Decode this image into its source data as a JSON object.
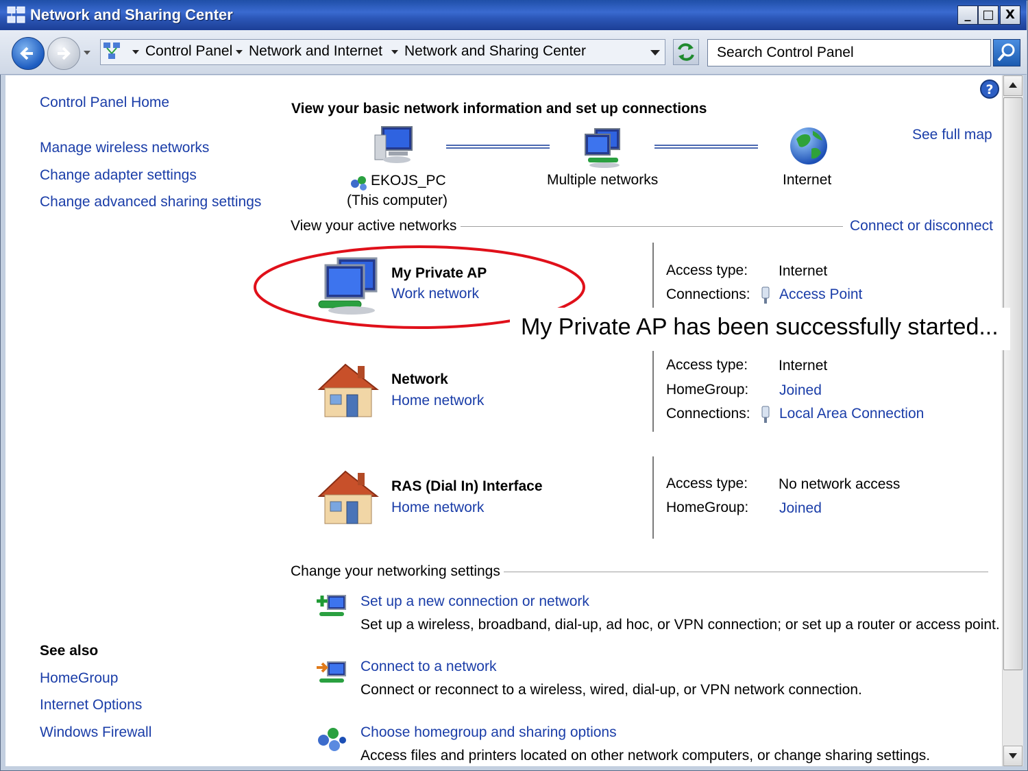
{
  "window": {
    "title": "Network and Sharing Center",
    "buttons": {
      "minimize": "_",
      "maximize": "□",
      "close": "X"
    }
  },
  "nav": {
    "breadcrumbs": [
      "Control Panel",
      "Network and Internet",
      "Network and Sharing Center"
    ],
    "search_placeholder": "Search Control Panel"
  },
  "sidebar": {
    "home_link": "Control Panel Home",
    "tasks": [
      "Manage wireless networks",
      "Change adapter settings",
      "Change advanced sharing settings"
    ],
    "see_also_heading": "See also",
    "see_also": [
      "HomeGroup",
      "Internet Options",
      "Windows Firewall"
    ]
  },
  "main": {
    "heading": "View your basic network information and set up connections",
    "see_full_map": "See full map",
    "map": {
      "computer_name": "EKOJS_PC",
      "computer_sub": "(This computer)",
      "middle": "Multiple networks",
      "internet": "Internet"
    },
    "active_networks_label": "View your active networks",
    "connect_or_disconnect": "Connect or disconnect",
    "networks": [
      {
        "name": "My Private AP",
        "type": "Work network",
        "props": [
          {
            "label": "Access type:",
            "value": "Internet",
            "is_link": false
          },
          {
            "label": "Connections:",
            "value": "Access Point",
            "is_link": true
          }
        ]
      },
      {
        "name": "Network",
        "type": "Home network",
        "props": [
          {
            "label": "Access type:",
            "value": "Internet",
            "is_link": false
          },
          {
            "label": "HomeGroup:",
            "value": "Joined",
            "is_link": true
          },
          {
            "label": "Connections:",
            "value": "Local Area Connection",
            "is_link": true
          }
        ]
      },
      {
        "name": "RAS (Dial In) Interface",
        "type": "Home network",
        "props": [
          {
            "label": "Access type:",
            "value": "No network access",
            "is_link": false
          },
          {
            "label": "HomeGroup:",
            "value": "Joined",
            "is_link": true
          }
        ]
      }
    ],
    "callout": "My Private AP has been successfully started...",
    "change_settings_label": "Change your networking settings",
    "tasks": [
      {
        "title": "Set up a new connection or network",
        "desc": "Set up a wireless, broadband, dial-up, ad hoc, or VPN connection; or set up a router or access point."
      },
      {
        "title": "Connect to a network",
        "desc": "Connect or reconnect to a wireless, wired, dial-up, or VPN network connection."
      },
      {
        "title": "Choose homegroup and sharing options",
        "desc": "Access files and printers located on other network computers, or change sharing settings."
      }
    ]
  },
  "colors": {
    "link": "#1a3da8",
    "titlebar": "#2c57b8",
    "callout_ellipse": "#e0101a"
  },
  "icons": [
    "back-arrow-icon",
    "forward-arrow-icon",
    "network-folder-icon",
    "refresh-icon",
    "search-icon",
    "help-icon",
    "computer-icon",
    "networks-icon",
    "globe-icon",
    "work-network-icon",
    "house-icon",
    "adapter-icon",
    "setup-connection-icon",
    "connect-network-icon",
    "homegroup-icon"
  ]
}
